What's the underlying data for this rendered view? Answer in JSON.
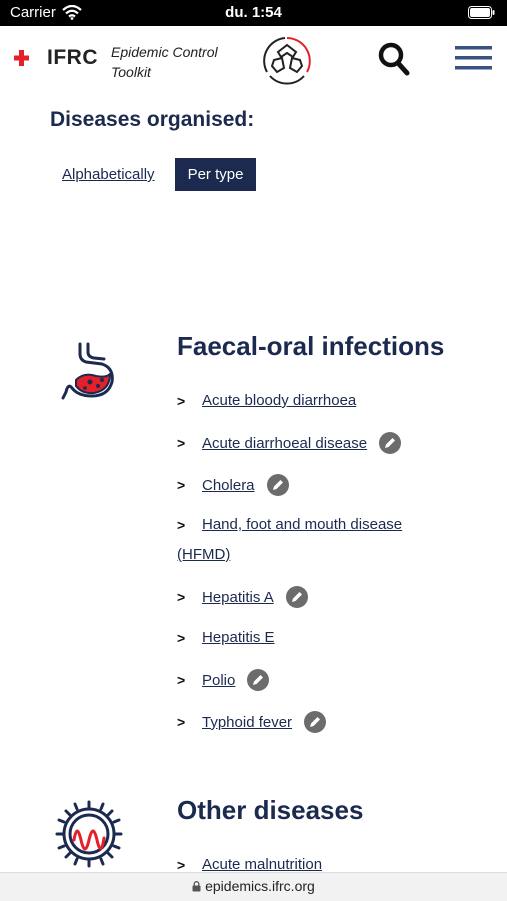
{
  "status_bar": {
    "carrier": "Carrier",
    "time": "du. 1:54"
  },
  "header": {
    "org_logo_text": "IFRC",
    "app_title_line1": "Epidemic Control",
    "app_title_line2": "Toolkit"
  },
  "filter": {
    "heading": "Diseases organised:",
    "option_alphabetical": "Alphabetically",
    "option_per_type": "Per type",
    "selected": "Per type"
  },
  "categories": [
    {
      "title": "Faecal-oral infections",
      "icon": "stomach-icon",
      "items": [
        {
          "label": "Acute bloody diarrhoea",
          "has_edit": false
        },
        {
          "label": "Acute diarrhoeal disease",
          "has_edit": true
        },
        {
          "label": "Cholera",
          "has_edit": true
        },
        {
          "label": "Hand, foot and mouth disease",
          "label_cont": "(HFMD)",
          "has_edit": false
        },
        {
          "label": "Hepatitis A",
          "has_edit": true
        },
        {
          "label": "Hepatitis E",
          "has_edit": false
        },
        {
          "label": "Polio",
          "has_edit": true
        },
        {
          "label": "Typhoid fever",
          "has_edit": true
        }
      ]
    },
    {
      "title": "Other diseases",
      "icon": "virus-icon",
      "items": [
        {
          "label": "Acute malnutrition",
          "has_edit": false
        }
      ]
    }
  ],
  "url_bar": {
    "url": "epidemics.ifrc.org"
  },
  "colors": {
    "primary": "#1b2a4e",
    "ifrc_red": "#e4202a",
    "badge_grey": "#6c6c6c"
  }
}
